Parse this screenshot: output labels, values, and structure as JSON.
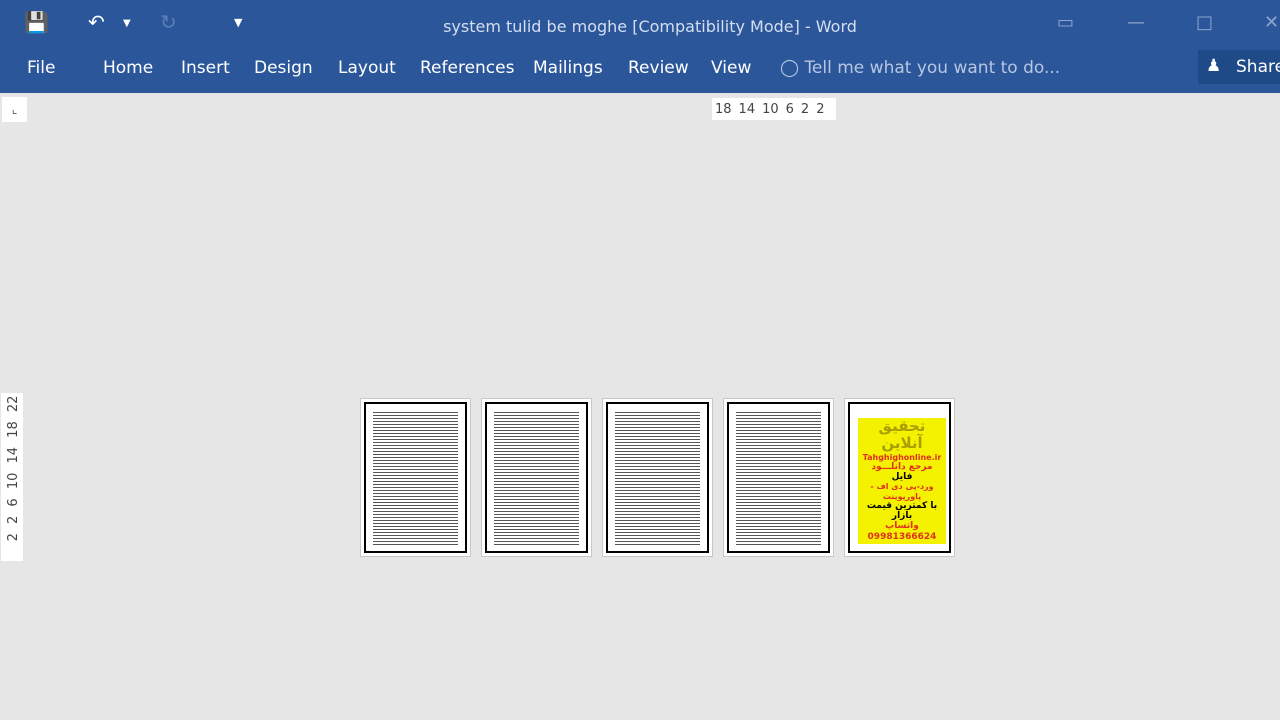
{
  "window": {
    "title": "system tulid be moghe [Compatibility Mode] - Word"
  },
  "qat": {
    "save": "floppy-disk-icon",
    "undo": "undo-icon",
    "redo": "redo-icon",
    "customize": "customize-qat-icon"
  },
  "tabs": [
    "File",
    "Home",
    "Insert",
    "Design",
    "Layout",
    "References",
    "Mailings",
    "Review",
    "View"
  ],
  "tellme": {
    "placeholder": "Tell me what you want to do..."
  },
  "share": {
    "label": "Share"
  },
  "ruler": {
    "horizontal": [
      "18",
      "14",
      "10",
      "6",
      "2",
      "2"
    ],
    "vertical": "2 2 6 10 14 18 22"
  },
  "pages": {
    "ad": {
      "title": "تحقیق آنلاین",
      "site": "Tahghighonline.ir",
      "line1": "مرجع دانلـــود",
      "line2": "فایل",
      "line3": "ورد-پی دی اف - پاورپوینت",
      "line4": "با کمترین قیمت بازار",
      "phone": "09981366624",
      "line5": "واتساپ"
    }
  },
  "colors": {
    "ribbon": "#2b579a",
    "canvas": "#e6e6e6",
    "ad_bg": "#f4f200"
  }
}
